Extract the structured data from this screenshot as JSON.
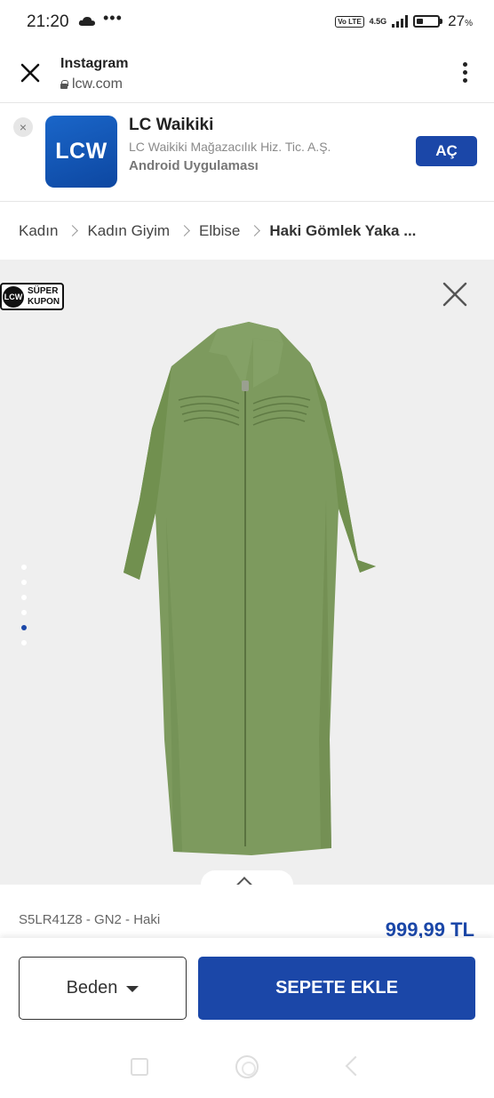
{
  "status_bar": {
    "time": "21:20",
    "volte": "Vo LTE",
    "network": "4.5G",
    "battery_percent": "27",
    "battery_unit": "%"
  },
  "browser_bar": {
    "title": "Instagram",
    "url": "lcw.com"
  },
  "app_banner": {
    "logo_text": "LCW",
    "app_name": "LC Waikiki",
    "publisher": "LC Waikiki Mağazacılık Hiz. Tic. A.Ş.",
    "type": "Android Uygulaması",
    "open_label": "AÇ",
    "close_label": "×"
  },
  "breadcrumb": {
    "items": [
      "Kadın",
      "Kadın Giyim",
      "Elbise"
    ],
    "current": "Haki Gömlek Yaka ..."
  },
  "gallery": {
    "badge_line1": "SÜPER",
    "badge_line2": "KUPON",
    "badge_logo": "LCW",
    "image_count": 6,
    "active_index": 4,
    "dress_color": "#7d9a5e"
  },
  "product": {
    "sku": "S5LR41Z8 - GN2 - Haki",
    "price": "999,99 TL"
  },
  "actions": {
    "size_label": "Beden",
    "add_to_cart_label": "SEPETE EKLE"
  },
  "colors": {
    "brand_blue": "#1b47a8"
  }
}
